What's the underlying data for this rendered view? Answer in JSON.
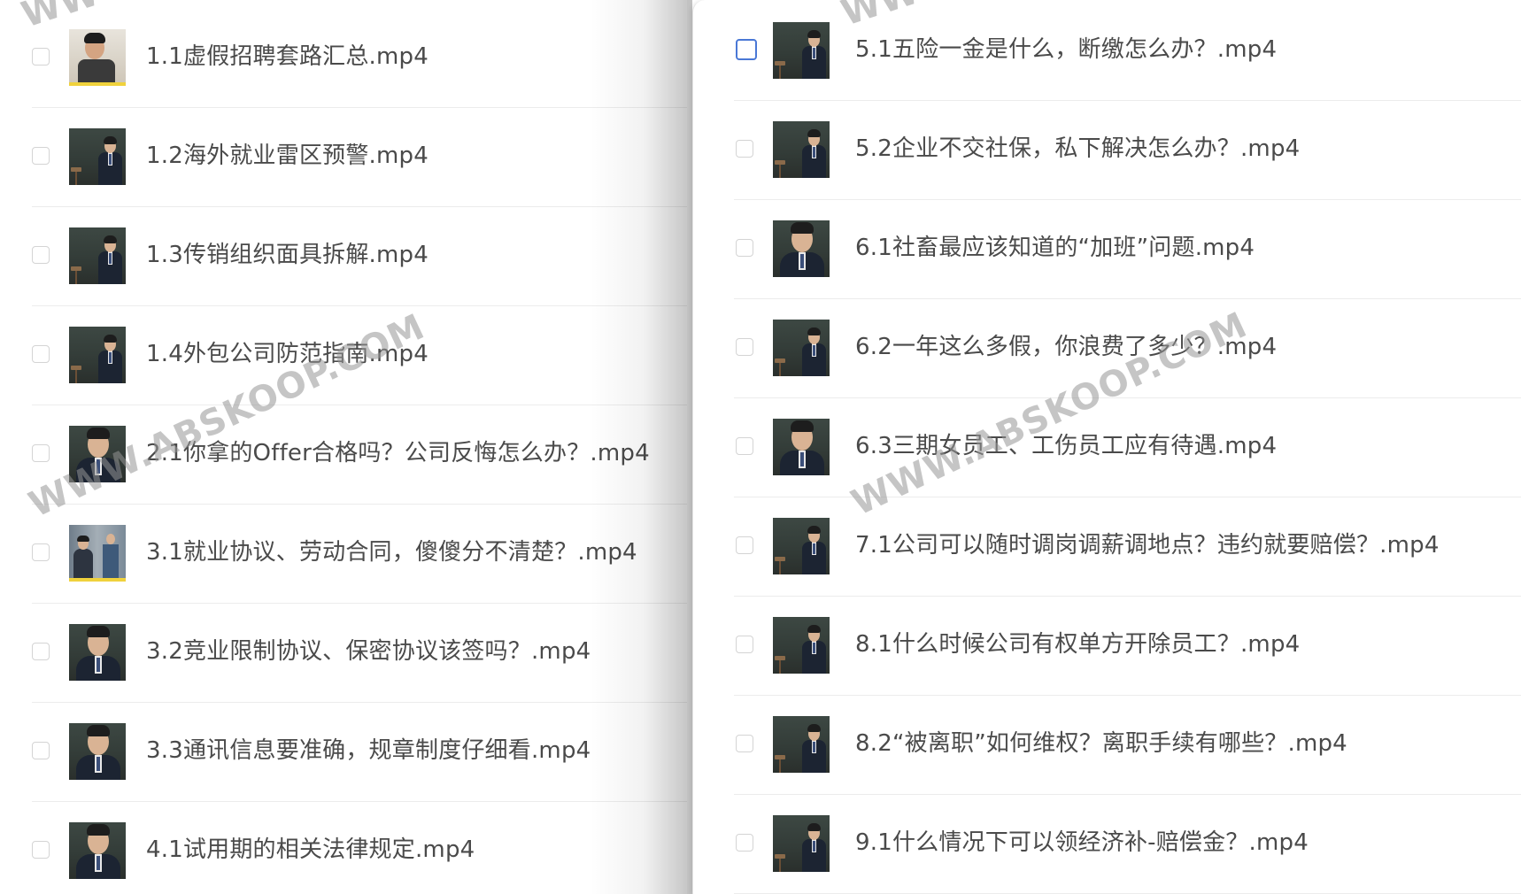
{
  "left_panel": {
    "files": [
      {
        "name": "1.1虚假招聘套路汇总.mp4",
        "checked": false,
        "thumbnail": "man-on-phone-yellow"
      },
      {
        "name": "1.2海外就业雷区预警.mp4",
        "checked": false,
        "thumbnail": "speaker-wide"
      },
      {
        "name": "1.3传销组织面具拆解.mp4",
        "checked": false,
        "thumbnail": "speaker-wide"
      },
      {
        "name": "1.4外包公司防范指南.mp4",
        "checked": false,
        "thumbnail": "speaker-wide"
      },
      {
        "name": "2.1你拿的Offer合格吗？公司反悔怎么办？.mp4",
        "checked": false,
        "thumbnail": "speaker-closeup"
      },
      {
        "name": "3.1就业协议、劳动合同，傻傻分不清楚？.mp4",
        "checked": false,
        "thumbnail": "office-scene"
      },
      {
        "name": "3.2竞业限制协议、保密协议该签吗？.mp4",
        "checked": false,
        "thumbnail": "speaker-closeup"
      },
      {
        "name": "3.3通讯信息要准确，规章制度仔细看.mp4",
        "checked": false,
        "thumbnail": "speaker-closeup"
      },
      {
        "name": "4.1试用期的相关法律规定.mp4",
        "checked": false,
        "thumbnail": "speaker-closeup"
      }
    ]
  },
  "right_panel": {
    "files": [
      {
        "name": "5.1五险一金是什么，断缴怎么办？.mp4",
        "checked": false,
        "highlighted": true,
        "thumbnail": "speaker-wide"
      },
      {
        "name": "5.2企业不交社保，私下解决怎么办？.mp4",
        "checked": false,
        "thumbnail": "speaker-wide"
      },
      {
        "name": "6.1社畜最应该知道的“加班”问题.mp4",
        "checked": false,
        "thumbnail": "speaker-closeup"
      },
      {
        "name": "6.2一年这么多假，你浪费了多少？.mp4",
        "checked": false,
        "thumbnail": "speaker-wide"
      },
      {
        "name": "6.3三期女员工、工伤员工应有待遇.mp4",
        "checked": false,
        "thumbnail": "speaker-closeup"
      },
      {
        "name": "7.1公司可以随时调岗调薪调地点？违约就要赔偿？.mp4",
        "checked": false,
        "thumbnail": "speaker-wide"
      },
      {
        "name": "8.1什么时候公司有权单方开除员工？.mp4",
        "checked": false,
        "thumbnail": "speaker-wide"
      },
      {
        "name": "8.2“被离职”如何维权？离职手续有哪些？.mp4",
        "checked": false,
        "thumbnail": "speaker-wide"
      },
      {
        "name": "9.1什么情况下可以领经济补-赔偿金？.mp4",
        "checked": false,
        "thumbnail": "speaker-wide"
      }
    ]
  },
  "watermark": {
    "text": "WWW.ABSKOOP.COM",
    "fragment": "WW"
  },
  "colors": {
    "text": "#4a4a4a",
    "checkbox_border": "#d4d4d4",
    "checkbox_highlight": "#4a78d6",
    "divider": "#ececec",
    "watermark": "#969696"
  }
}
